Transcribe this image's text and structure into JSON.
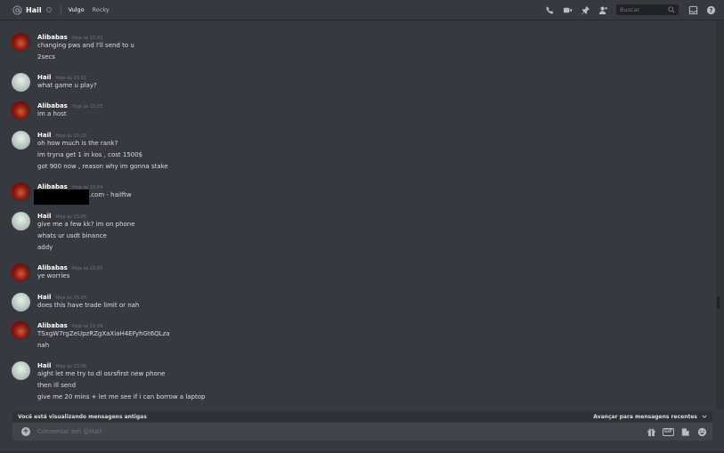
{
  "header": {
    "channel_name": "Hail",
    "friends": [
      "Vulgo",
      "Rocky"
    ],
    "search_placeholder": "Buscar"
  },
  "messages": [
    {
      "author": "Alibabas",
      "timestamp": "Hoje às 15:02",
      "lines": [
        "changing pws and I'll send to u",
        "2secs"
      ]
    },
    {
      "author": "Hail",
      "timestamp": "Hoje às 15:02",
      "lines": [
        "what game u play?"
      ]
    },
    {
      "author": "Alibabas",
      "timestamp": "Hoje às 15:03",
      "lines": [
        "im a host"
      ]
    },
    {
      "author": "Hail",
      "timestamp": "Hoje às 15:03",
      "lines": [
        "oh how much is the rank?",
        "im tryna get 1 in kos , cost 1500$",
        "got 900 now , reason why im gonna stake"
      ]
    },
    {
      "author": "Alibabas",
      "timestamp": "Hoje às 15:04",
      "lines": [
        ".com - hailftw"
      ]
    },
    {
      "author": "Hail",
      "timestamp": "Hoje às 15:05",
      "lines": [
        "give me a few kk? im on phone",
        "whats ur usdt binance",
        "addy"
      ]
    },
    {
      "author": "Alibabas",
      "timestamp": "Hoje às 15:05",
      "lines": [
        "ye worries"
      ]
    },
    {
      "author": "Hail",
      "timestamp": "Hoje às 15:05",
      "lines": [
        "does this have trade limit or nah"
      ]
    },
    {
      "author": "Alibabas",
      "timestamp": "Hoje às 15:06",
      "lines": [
        "TSxgW7rgZeUpzRZgXaXiaH4EFyhGt6QLza",
        "nah"
      ]
    },
    {
      "author": "Hail",
      "timestamp": "Hoje às 15:06",
      "lines": [
        "aight let me try to dl osrsfirst new phone",
        "then ill send",
        "give me 20 mins + let me see if i can borrow a laptop"
      ]
    }
  ],
  "banner": {
    "old_messages_text": "Você está visualizando mensagens antigas",
    "jump_label": "Avançar para mensagens recentes"
  },
  "composer": {
    "placeholder": "Conversar em @Hail"
  },
  "icons": {
    "gif_label": "GIF"
  }
}
